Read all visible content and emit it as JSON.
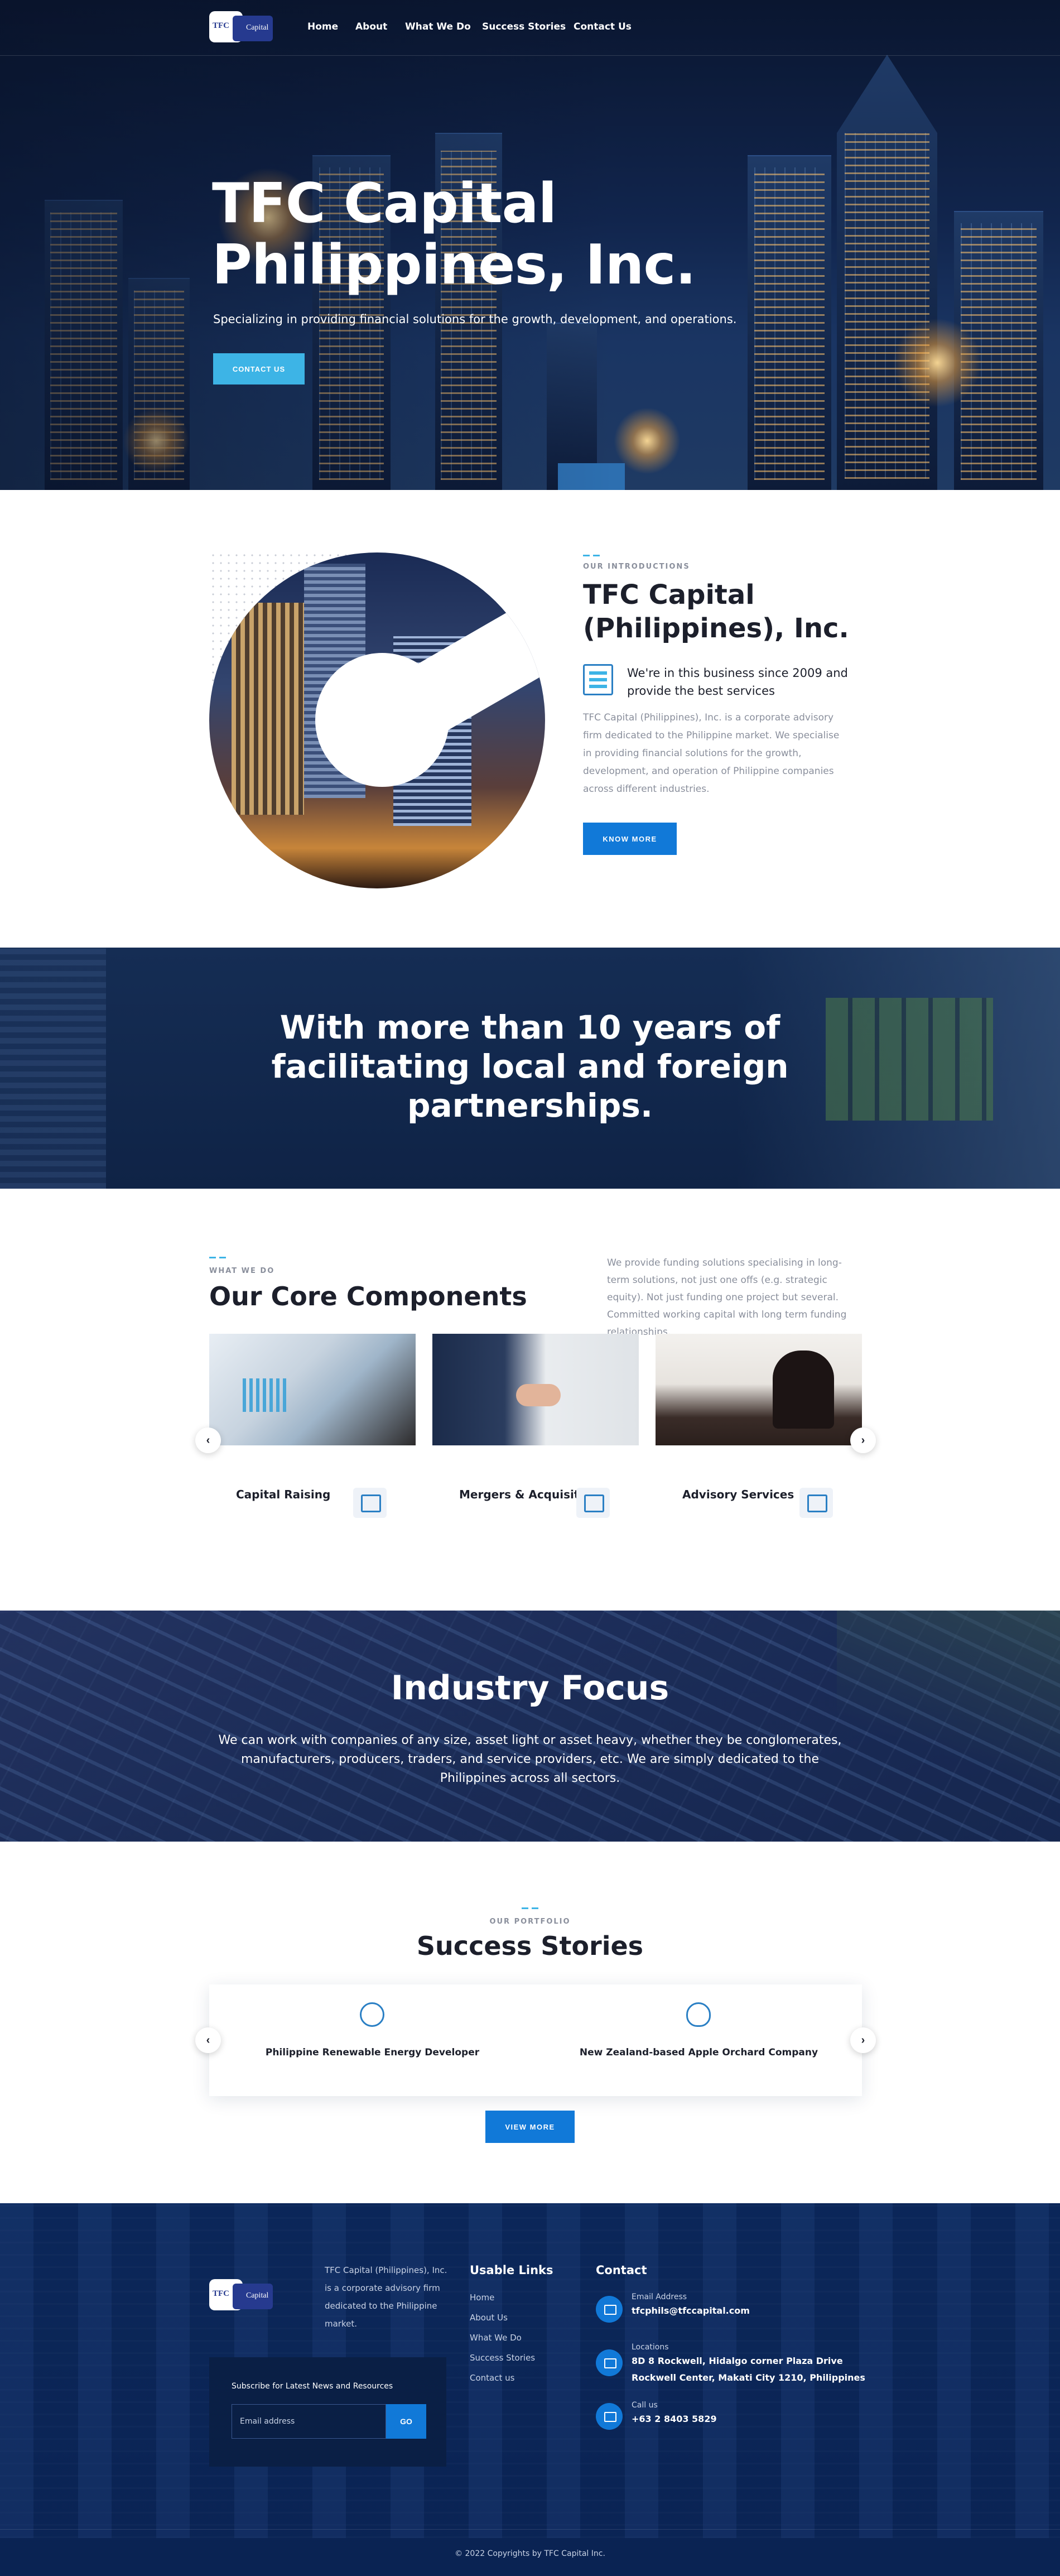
{
  "nav": {
    "logo_text_left": "TFC",
    "logo_text_right": "Capital",
    "links": [
      "Home",
      "About",
      "What We Do",
      "Success Stories",
      "Contact Us"
    ]
  },
  "hero": {
    "title": "TFC Capital Philippines, Inc.",
    "subtitle": "Specializing in providing financial solutions for the growth, development, and operations.",
    "button": "CONTACT US"
  },
  "intro": {
    "eyebrow": "OUR INTRODUCTIONS",
    "title": "TFC Capital (Philippines), Inc.",
    "since": "We're in this business since 2009 and provide the best services",
    "body": "TFC Capital (Philippines), Inc. is a corporate advisory firm dedicated to the Philippine market. We specialise in providing financial solutions for the growth, development, and operation of Philippine companies across different industries.",
    "button": "KNOW MORE"
  },
  "banner": {
    "text": "With more than 10 years of facilitating local and foreign partnerships."
  },
  "core": {
    "eyebrow": "WHAT WE DO",
    "title": "Our Core Components",
    "description": "We provide funding solutions specialising in long-term solutions, not just one offs (e.g. strategic equity). Not just funding one project but several. Committed working capital with long term funding relationships.",
    "cards": [
      {
        "label": "Capital Raising",
        "icon": "chart-document-icon"
      },
      {
        "label": "Mergers & Acquisition",
        "icon": "handshake-icon"
      },
      {
        "label": "Advisory Services",
        "icon": "dollar-hand-icon"
      }
    ],
    "prev": "‹",
    "next": "›"
  },
  "industry": {
    "title": "Industry Focus",
    "text": "We can work with companies of any size, asset light or asset heavy, whether they be conglomerates, manufacturers, producers, traders, and service providers, etc. We are simply dedicated to the Philippines across all sectors."
  },
  "success": {
    "eyebrow": "OUR PORTFOLIO",
    "title": "Success Stories",
    "stories": [
      {
        "label": "Philippine Renewable Energy Developer",
        "icon": "sun-icon"
      },
      {
        "label": "New Zealand-based Apple Orchard Company",
        "icon": "apple-icon"
      }
    ],
    "prev": "‹",
    "next": "›",
    "button": "VIEW MORE"
  },
  "footer": {
    "about": "TFC Capital (Philippines), Inc. is a corporate advisory firm dedicated to the Philippine market.",
    "subscribe_label": "Subscribe for Latest News and Resources",
    "email_placeholder": "Email address",
    "subscribe_button": "GO",
    "links_heading": "Usable Links",
    "links": [
      "Home",
      "About Us",
      "What We Do",
      "Success Stories",
      "Contact us"
    ],
    "contact_heading": "Contact",
    "contact": [
      {
        "label": "Email Address",
        "value": "tfcphils@tfccapital.com",
        "icon": "email-icon"
      },
      {
        "label": "Locations",
        "value": "8D 8 Rockwell, Hidalgo corner Plaza Drive Rockwell Center, Makati City 1210, Philippines",
        "icon": "location-pin-icon"
      },
      {
        "label": "Call us",
        "value": "+63 2 8403 5829",
        "icon": "phone-icon"
      }
    ],
    "copyright": "© 2022 Copyrights by TFC Capital Inc."
  },
  "colors": {
    "accent": "#1179d8",
    "light_accent": "#3db4e6",
    "navy": "#0c2450"
  }
}
